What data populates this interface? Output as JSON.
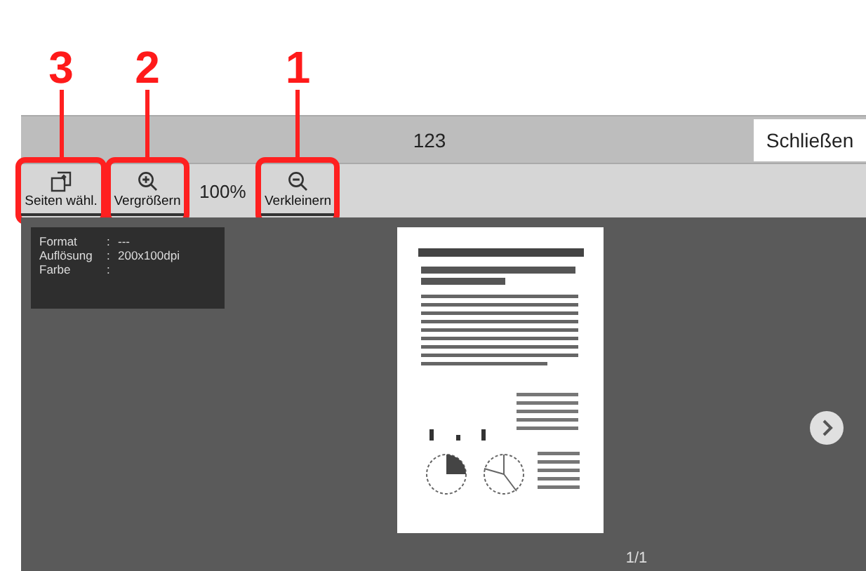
{
  "title_bar": {
    "title": "123",
    "close_button": "Schließen"
  },
  "toolbar": {
    "items": [
      {
        "kind": "pages",
        "label": "Seiten wähl.",
        "callout": "3"
      },
      {
        "kind": "zoom_in",
        "label": "Vergrößern",
        "callout": "2"
      },
      {
        "kind": "zoom_level",
        "label": "100%"
      },
      {
        "kind": "zoom_out",
        "label": "Verkleinern",
        "callout": "1"
      }
    ]
  },
  "info_panel": {
    "rows": [
      {
        "label": "Format",
        "separator": ":",
        "value": "---"
      },
      {
        "label": "Auflösung",
        "separator": ":",
        "value": "200x100dpi"
      },
      {
        "label": "Farbe",
        "separator": ":"
      }
    ]
  },
  "preview": {
    "page_counter": "1/1"
  }
}
